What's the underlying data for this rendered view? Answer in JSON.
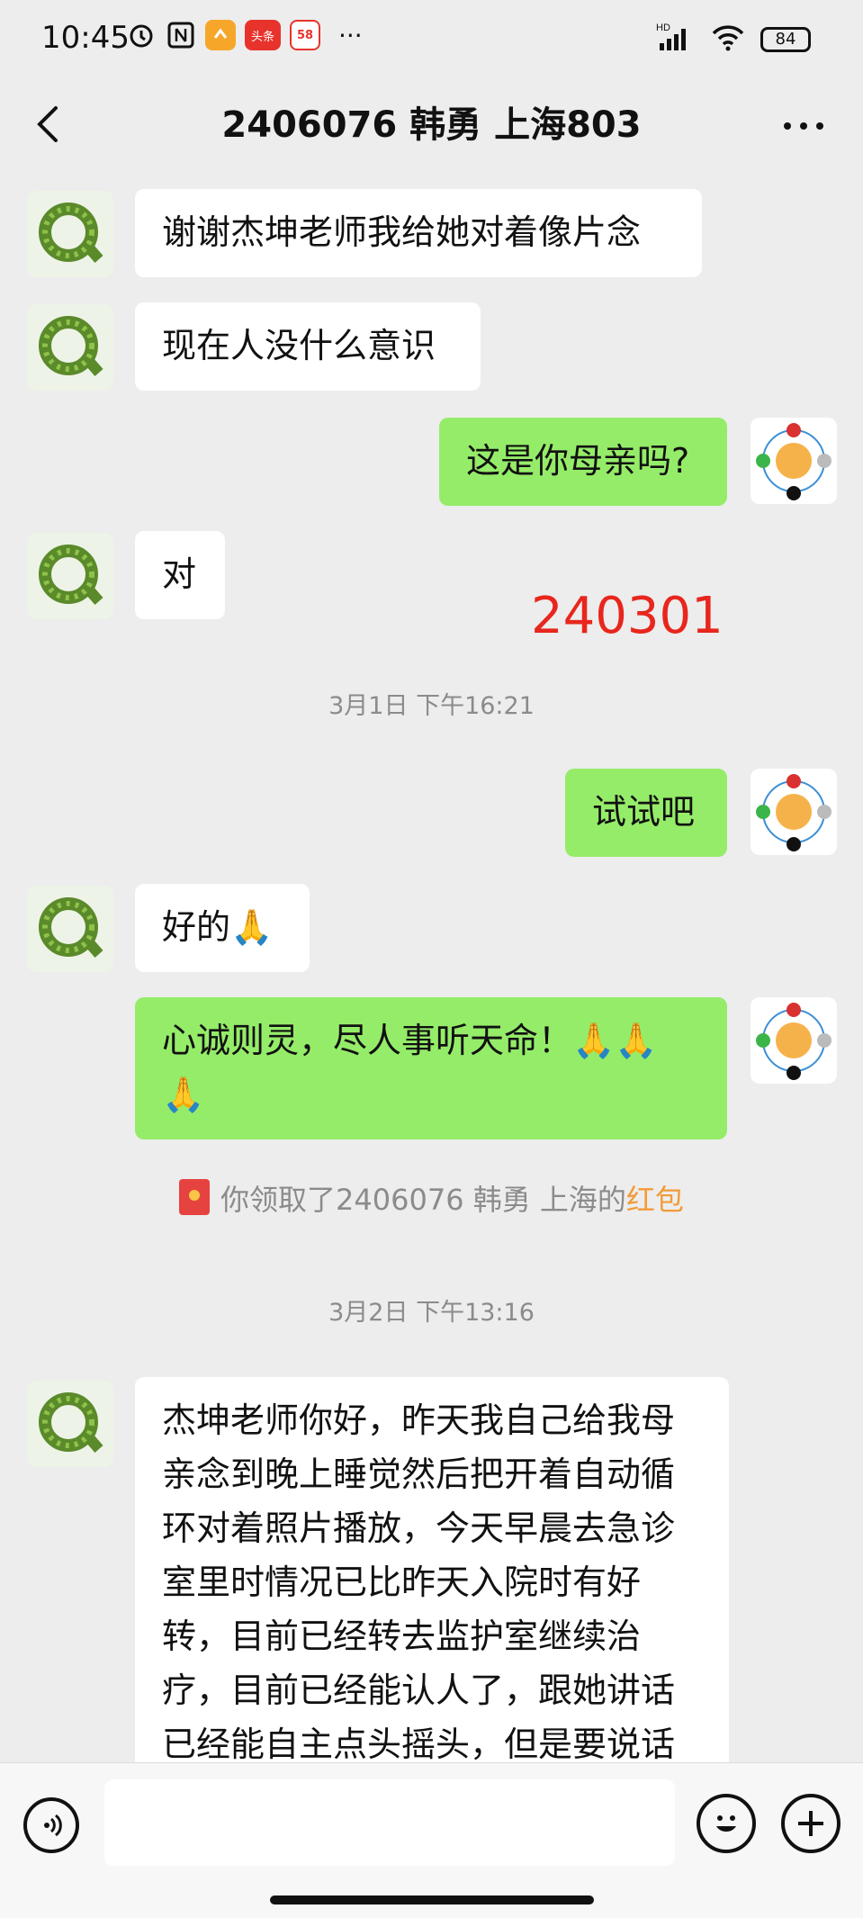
{
  "status_bar": {
    "time": "10:45",
    "app_icons": [
      "alarm-icon",
      "nfc-icon",
      "orange-app-icon",
      "toutiao-app-icon",
      "58-app-icon"
    ],
    "app_icon_labels": [
      "",
      "",
      "",
      "头条",
      "58"
    ],
    "more": "···",
    "network": "HD",
    "battery": "84"
  },
  "header": {
    "title": "2406076 韩勇 上海803",
    "back_icon": "chevron-left-icon",
    "more_icon": "more-dots-icon",
    "more_label": "···"
  },
  "messages": [
    {
      "side": "in",
      "text": "谢谢杰坤老师我给她对着像片念"
    },
    {
      "side": "in",
      "text": "现在人没什么意识"
    },
    {
      "side": "out",
      "text": "这是你母亲吗?"
    },
    {
      "side": "in",
      "text": "对"
    },
    {
      "side": "out",
      "text": "试试吧"
    },
    {
      "side": "in",
      "text": "好的🙏"
    },
    {
      "side": "out",
      "text_line1": "心诚则灵，尽人事听天命！🙏🙏",
      "text_line2": "🙏"
    },
    {
      "side": "in",
      "lines": [
        "杰坤老师你好，昨天我自己给我母",
        "亲念到晚上睡觉然后把开着自动循",
        "环对着照片播放，今天早晨去急诊",
        "室里时情况已比昨天入院时有好",
        "转，目前已经转去监护室继续治",
        "疗，目前已经能认人了，跟她讲话",
        "已经能自主点头摇头，但是要说话"
      ]
    }
  ],
  "annotation": "240301",
  "timestamps": [
    "3月1日 下午16:21",
    "3月2日 下午13:16"
  ],
  "red_packet": {
    "prefix": "你领取了2406076 韩勇 上海的",
    "link": "红包"
  },
  "input_bar": {
    "voice_icon": "voice-icon",
    "emoji_icon": "emoji-icon",
    "plus_icon": "plus-icon",
    "placeholder": ""
  },
  "colors": {
    "background": "#ededed",
    "incoming_bubble": "#ffffff",
    "outgoing_bubble": "#95ec69",
    "annotation": "#e8261d",
    "red_packet_link": "#f29b38"
  }
}
